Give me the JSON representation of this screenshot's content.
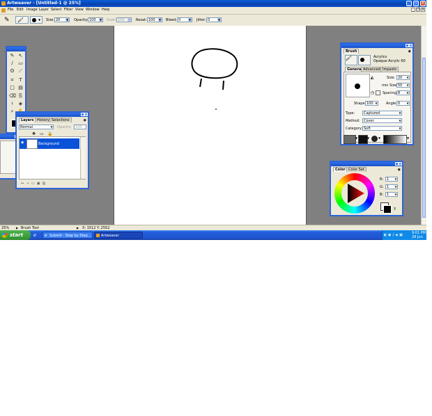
{
  "window": {
    "title": "Artweaver - [Untitled-1 @ 25%]"
  },
  "menu": {
    "items": [
      "File",
      "Edit",
      "Image",
      "Layer",
      "Select",
      "Filter",
      "View",
      "Window",
      "Help"
    ]
  },
  "options": {
    "size_label": "Size:",
    "size_value": "20",
    "opacity_label": "Opacity:",
    "opacity_value": "100",
    "grain_label": "Grain:",
    "grain_value": "100",
    "resat_label": "Resat:",
    "resat_value": "100",
    "bleed_label": "Bleed:",
    "bleed_value": "0",
    "jitter_label": "Jitter:",
    "jitter_value": "0"
  },
  "layers_panel": {
    "tabs": [
      "Layers",
      "History",
      "Selections"
    ],
    "blend_mode": "Normal",
    "opacity_label": "Opacity:",
    "opacity_value": "100",
    "layer_name": "Background"
  },
  "brush_panel": {
    "title": "Brush",
    "category": "Acrylics",
    "variant": "Opaque Acrylic 60",
    "tabs": [
      "General",
      "Advanced",
      "Impasto"
    ],
    "size_label": "Size:",
    "size_value": "20",
    "minsize_label": "min Size:",
    "minsize_value": "50",
    "spacing_label": "Spacing:",
    "spacing_value": "8",
    "shape_label": "Shape:",
    "shape_value": "100",
    "angle_label": "Angle:",
    "angle_value": "0",
    "type_label": "Type:",
    "type_value": "Captured",
    "method_label": "Method:",
    "method_value": "Cover",
    "cat_label": "Category:",
    "cat_value": "Soft"
  },
  "color_panel": {
    "tabs": [
      "Color",
      "Color Set"
    ],
    "r_label": "R:",
    "r_value": "1",
    "g_label": "G:",
    "g_value": "1",
    "b_label": "B:",
    "b_value": "1"
  },
  "status": {
    "zoom": "25%",
    "tool": "Brush Tool",
    "coords": "X: 1512  Y: 2552"
  },
  "taskbar": {
    "start": "start",
    "tasks": [
      "Submit - Step by Step...",
      "Artweaver"
    ],
    "time": "9:01 PM",
    "date": "28 Jun"
  },
  "colors": {
    "accent": "#2d64d8",
    "workspace": "#808080",
    "taskbar": "#245edb",
    "start": "#3a9c3a"
  }
}
